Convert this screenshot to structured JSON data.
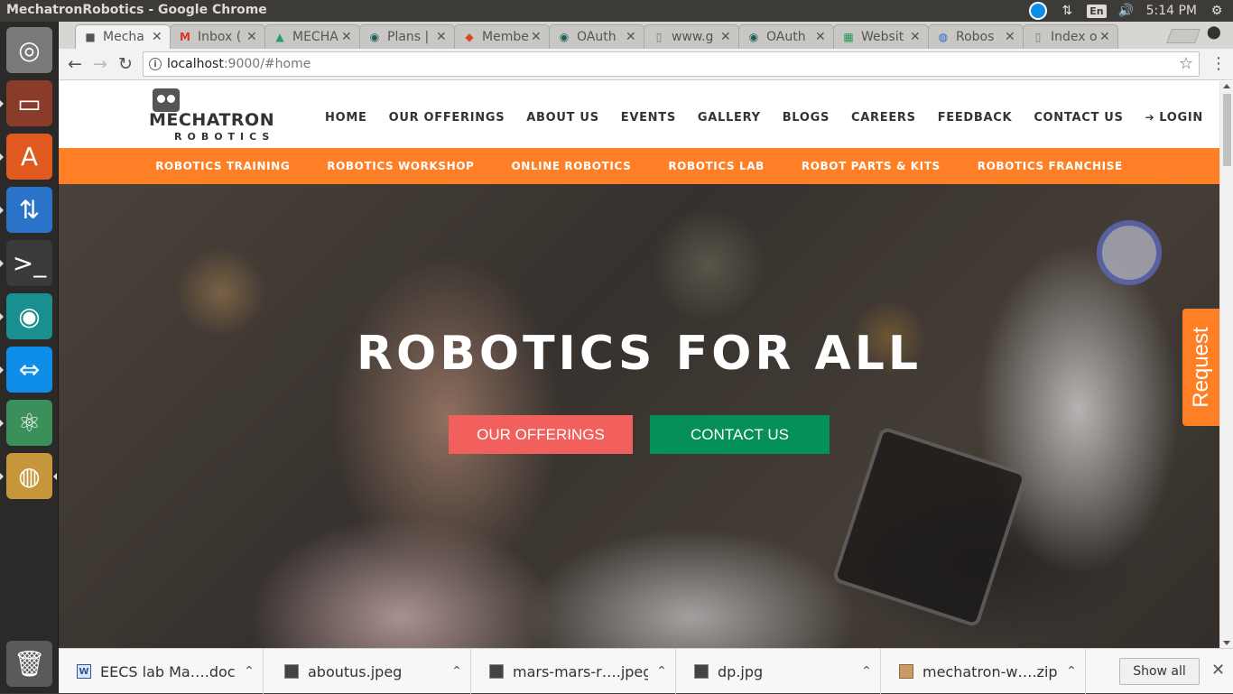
{
  "window": {
    "title": "MechatronRobotics - Google Chrome"
  },
  "tray": {
    "keyboard": "En",
    "time": "5:14 PM"
  },
  "launcher": [
    {
      "name": "ubuntu-dash-icon",
      "glyph": "◎",
      "color": "#7a7a7a"
    },
    {
      "name": "files-icon",
      "glyph": "▭",
      "color": "#8a3b2a"
    },
    {
      "name": "software-center-icon",
      "glyph": "A",
      "color": "#e05a1f"
    },
    {
      "name": "transfer-icon",
      "glyph": "⇅",
      "color": "#2a73c9"
    },
    {
      "name": "terminal-icon",
      "glyph": ">_",
      "color": "#3a3a3a"
    },
    {
      "name": "gitkraken-icon",
      "glyph": "◉",
      "color": "#1a8f8f"
    },
    {
      "name": "teamviewer-icon",
      "glyph": "⇔",
      "color": "#0e8ee9"
    },
    {
      "name": "atom-icon",
      "glyph": "⚛",
      "color": "#3b8f5a"
    },
    {
      "name": "chrome-icon",
      "glyph": "◍",
      "color": "#c6973a"
    },
    {
      "name": "trash-icon",
      "glyph": "🗑",
      "color": "#5a5a5a"
    }
  ],
  "tabs": [
    {
      "label": "Mecha",
      "favicon": "■",
      "favicon_color": "#555"
    },
    {
      "label": "Inbox (",
      "favicon": "M",
      "favicon_color": "#d93025"
    },
    {
      "label": "MECHA",
      "favicon": "▲",
      "favicon_color": "#1fa463"
    },
    {
      "label": "Plans |",
      "favicon": "◉",
      "favicon_color": "#1a5f5f"
    },
    {
      "label": "Membe",
      "favicon": "◆",
      "favicon_color": "#e24329"
    },
    {
      "label": "OAuth",
      "favicon": "◉",
      "favicon_color": "#1a5f5f"
    },
    {
      "label": "www.g",
      "favicon": "▯",
      "favicon_color": "#777"
    },
    {
      "label": "OAuth",
      "favicon": "◉",
      "favicon_color": "#1a5f5f"
    },
    {
      "label": "Websit",
      "favicon": "▦",
      "favicon_color": "#1f9b4f"
    },
    {
      "label": "Robos",
      "favicon": "◍",
      "favicon_color": "#3366cc"
    },
    {
      "label": "Index o",
      "favicon": "▯",
      "favicon_color": "#777"
    }
  ],
  "address": {
    "host": "localhost",
    "rest": ":9000/#home"
  },
  "site": {
    "logo_word1": "MECHATRON",
    "logo_word2": "ROBOTICS",
    "nav": [
      "HOME",
      "OUR OFFERINGS",
      "ABOUT US",
      "EVENTS",
      "GALLERY",
      "BLOGS",
      "CAREERS",
      "FEEDBACK",
      "CONTACT US",
      "LOGIN"
    ],
    "subnav": [
      "ROBOTICS TRAINING",
      "ROBOTICS WORKSHOP",
      "ONLINE ROBOTICS",
      "ROBOTICS LAB",
      "ROBOT PARTS & KITS",
      "ROBOTICS FRANCHISE"
    ],
    "hero_title": "ROBOTICS FOR ALL",
    "hero_btn_offerings": "OUR OFFERINGS",
    "hero_btn_contact": "CONTACT US",
    "request_tab": "Request",
    "colors": {
      "orange": "#ff7f27",
      "red_button": "#f2605d",
      "green_button": "#069059"
    }
  },
  "downloads": {
    "items": [
      {
        "name": "EECS lab Ma….doc",
        "type": "doc"
      },
      {
        "name": "aboutus.jpeg",
        "type": "image"
      },
      {
        "name": "mars-mars-r….jpeg",
        "type": "image"
      },
      {
        "name": "dp.jpg",
        "type": "image"
      },
      {
        "name": "mechatron-w….zip",
        "type": "zip"
      }
    ],
    "show_all": "Show all"
  }
}
